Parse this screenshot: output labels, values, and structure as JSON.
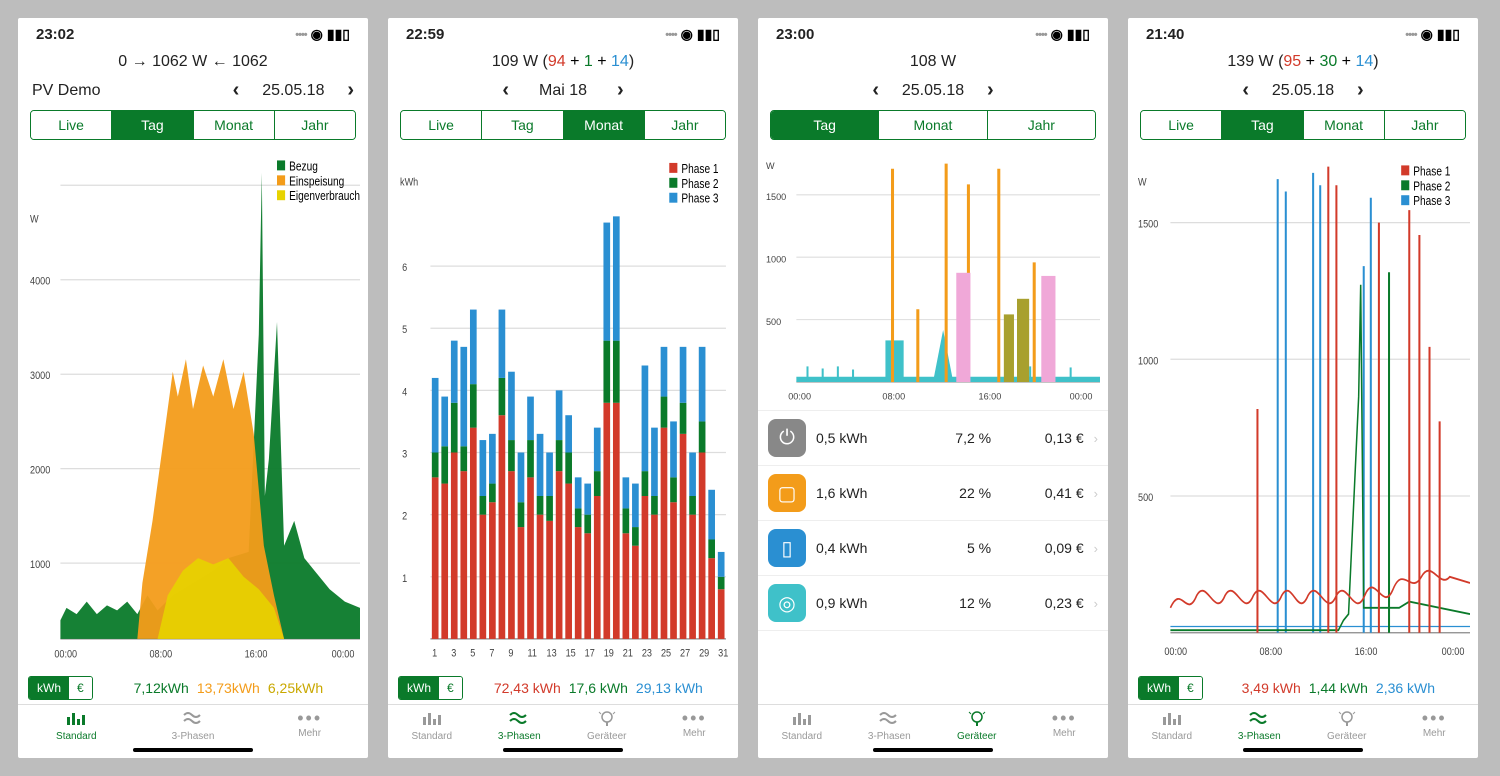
{
  "colors": {
    "green": "#0a7a2a",
    "orange": "#f39c1a",
    "yellow": "#e7d300",
    "red": "#d23a2a",
    "blue": "#2a8fd2",
    "teal": "#3fc1c9",
    "pink": "#f0a8d8",
    "olive": "#a8a02e",
    "gray": "#888"
  },
  "screens": [
    {
      "statusbar_time": "23:02",
      "summary_html": "0 → 1062 W ← 1062",
      "nav_left_label": "PV Demo",
      "nav_date": "25.05.18",
      "segments": [
        "Live",
        "Tag",
        "Monat",
        "Jahr"
      ],
      "segment_active": 1,
      "legend": [
        {
          "label": "Bezug",
          "color": "#0a7a2a"
        },
        {
          "label": "Einspeisung",
          "color": "#f39c1a"
        },
        {
          "label": "Eigenverbrauch",
          "color": "#e7d300"
        }
      ],
      "unit_options": [
        "kWh",
        "€"
      ],
      "unit_active": 0,
      "footer_values": [
        {
          "text": "7,12kWh",
          "color": "#0a7a2a"
        },
        {
          "text": "13,73kWh",
          "color": "#f39c1a"
        },
        {
          "text": "6,25kWh",
          "color": "#c9a800"
        }
      ],
      "tabs": [
        {
          "label": "Standard",
          "icon": "bars"
        },
        {
          "label": "3-Phasen",
          "icon": "waves"
        },
        {
          "label": "Mehr",
          "icon": "dots"
        }
      ],
      "tab_active": 0
    },
    {
      "statusbar_time": "22:59",
      "summary_prefix": "109 W (",
      "summary_parts": [
        {
          "text": "94",
          "color": "#d23a2a"
        },
        {
          "text": " + ",
          "color": "#000"
        },
        {
          "text": "1",
          "color": "#0a7a2a"
        },
        {
          "text": " + ",
          "color": "#000"
        },
        {
          "text": "14",
          "color": "#2a8fd2"
        }
      ],
      "summary_suffix": ")",
      "nav_date": "Mai 18",
      "segments": [
        "Live",
        "Tag",
        "Monat",
        "Jahr"
      ],
      "segment_active": 2,
      "legend": [
        {
          "label": "Phase 1",
          "color": "#d23a2a"
        },
        {
          "label": "Phase 2",
          "color": "#0a7a2a"
        },
        {
          "label": "Phase 3",
          "color": "#2a8fd2"
        }
      ],
      "unit_options": [
        "kWh",
        "€"
      ],
      "unit_active": 0,
      "footer_values": [
        {
          "text": "72,43 kWh",
          "color": "#d23a2a"
        },
        {
          "text": "17,6 kWh",
          "color": "#0a7a2a"
        },
        {
          "text": "29,13 kWh",
          "color": "#2a8fd2"
        }
      ],
      "tabs": [
        {
          "label": "Standard",
          "icon": "bars"
        },
        {
          "label": "3-Phasen",
          "icon": "waves"
        },
        {
          "label": "Geräteer",
          "icon": "bulb"
        },
        {
          "label": "Mehr",
          "icon": "dots"
        }
      ],
      "tab_active": 1
    },
    {
      "statusbar_time": "23:00",
      "summary_html": "108 W",
      "nav_date": "25.05.18",
      "segments": [
        "Tag",
        "Monat",
        "Jahr"
      ],
      "segment_active": 0,
      "unit_options": [
        "kWh",
        "€"
      ],
      "unit_active": 0,
      "devices": [
        {
          "icon_bg": "#888",
          "glyph": "⏻",
          "kwh": "0,5 kWh",
          "pct": "7,2 %",
          "eur": "0,13 €"
        },
        {
          "icon_bg": "#f39c1a",
          "glyph": "▢",
          "kwh": "1,6 kWh",
          "pct": "22 %",
          "eur": "0,41 €"
        },
        {
          "icon_bg": "#2a8fd2",
          "glyph": "▯",
          "kwh": "0,4 kWh",
          "pct": "5 %",
          "eur": "0,09 €"
        },
        {
          "icon_bg": "#3fc1c9",
          "glyph": "◎",
          "kwh": "0,9 kWh",
          "pct": "12 %",
          "eur": "0,23 €"
        }
      ],
      "tabs": [
        {
          "label": "Standard",
          "icon": "bars"
        },
        {
          "label": "3-Phasen",
          "icon": "waves"
        },
        {
          "label": "Geräteer",
          "icon": "bulb"
        },
        {
          "label": "Mehr",
          "icon": "dots"
        }
      ],
      "tab_active": 2
    },
    {
      "statusbar_time": "21:40",
      "summary_prefix": "139 W (",
      "summary_parts": [
        {
          "text": "95",
          "color": "#d23a2a"
        },
        {
          "text": " + ",
          "color": "#000"
        },
        {
          "text": "30",
          "color": "#0a7a2a"
        },
        {
          "text": " + ",
          "color": "#000"
        },
        {
          "text": "14",
          "color": "#2a8fd2"
        }
      ],
      "summary_suffix": ")",
      "nav_date": "25.05.18",
      "segments": [
        "Live",
        "Tag",
        "Monat",
        "Jahr"
      ],
      "segment_active": 1,
      "legend": [
        {
          "label": "Phase 1",
          "color": "#d23a2a"
        },
        {
          "label": "Phase 2",
          "color": "#0a7a2a"
        },
        {
          "label": "Phase 3",
          "color": "#2a8fd2"
        }
      ],
      "unit_options": [
        "kWh",
        "€"
      ],
      "unit_active": 0,
      "footer_values": [
        {
          "text": "3,49 kWh",
          "color": "#d23a2a"
        },
        {
          "text": "1,44 kWh",
          "color": "#0a7a2a"
        },
        {
          "text": "2,36 kWh",
          "color": "#2a8fd2"
        }
      ],
      "tabs": [
        {
          "label": "Standard",
          "icon": "bars"
        },
        {
          "label": "3-Phasen",
          "icon": "waves"
        },
        {
          "label": "Geräteer",
          "icon": "bulb"
        },
        {
          "label": "Mehr",
          "icon": "dots"
        }
      ],
      "tab_active": 1
    }
  ],
  "chart_data": [
    {
      "screen": 0,
      "type": "area",
      "xlabel": "",
      "ylabel": "W",
      "x_ticks": [
        "00:00",
        "08:00",
        "16:00",
        "00:00"
      ],
      "y_ticks": [
        1000,
        2000,
        3000,
        4000
      ],
      "ylim": [
        0,
        5200
      ],
      "note": "Daily power profile. Bezug = grid draw (green), Einspeisung = feed-in (orange), Eigenverbrauch = self-consumption (yellow). Large green spike ~16:00 to ~5000W."
    },
    {
      "screen": 1,
      "type": "bar",
      "ylabel": "kWh",
      "x_ticks": [
        1,
        3,
        5,
        7,
        9,
        11,
        13,
        15,
        17,
        19,
        21,
        23,
        25,
        27,
        29,
        31
      ],
      "y_ticks": [
        1,
        2,
        3,
        4,
        5,
        6
      ],
      "ylim": [
        0,
        7
      ],
      "categories": [
        1,
        2,
        3,
        4,
        5,
        6,
        7,
        8,
        9,
        10,
        11,
        12,
        13,
        14,
        15,
        16,
        17,
        18,
        19,
        20,
        21,
        22,
        23,
        24,
        25,
        26,
        27,
        28,
        29,
        30,
        31
      ],
      "series": [
        {
          "name": "Phase 1",
          "color": "#d23a2a",
          "values": [
            2.6,
            2.5,
            3.0,
            2.7,
            3.4,
            2.0,
            2.2,
            3.6,
            2.7,
            1.8,
            2.6,
            2.0,
            1.9,
            2.7,
            2.5,
            1.8,
            1.7,
            2.3,
            3.8,
            3.8,
            1.7,
            1.5,
            2.3,
            2.0,
            3.4,
            2.2,
            3.3,
            2.0,
            3.0,
            1.3,
            0.8
          ]
        },
        {
          "name": "Phase 2",
          "color": "#0a7a2a",
          "values": [
            0.4,
            0.6,
            0.8,
            0.4,
            0.7,
            0.3,
            0.3,
            0.6,
            0.5,
            0.4,
            0.6,
            0.3,
            0.4,
            0.5,
            0.5,
            0.3,
            0.3,
            0.4,
            1.0,
            1.0,
            0.4,
            0.3,
            0.4,
            0.3,
            0.5,
            0.4,
            0.5,
            0.3,
            0.5,
            0.3,
            0.2
          ]
        },
        {
          "name": "Phase 3",
          "color": "#2a8fd2",
          "values": [
            1.2,
            0.8,
            1.0,
            1.6,
            1.2,
            0.9,
            0.8,
            1.1,
            1.1,
            0.8,
            0.7,
            1.0,
            0.7,
            0.8,
            0.6,
            0.5,
            0.5,
            0.7,
            1.9,
            2.0,
            0.5,
            0.7,
            1.7,
            1.1,
            0.8,
            0.9,
            0.9,
            0.7,
            1.2,
            0.8,
            0.4
          ]
        }
      ]
    },
    {
      "screen": 2,
      "type": "line",
      "ylabel": "W",
      "x_ticks": [
        "00:00",
        "08:00",
        "16:00",
        "00:00"
      ],
      "y_ticks": [
        500,
        1000,
        1500
      ],
      "ylim": [
        0,
        2000
      ],
      "note": "Device disaggregation day profile. Teal base ~50W, orange spikes ~1800W around 08:00/12:00/14:00/16:00, pink blocks ~850W, olive ~600W after 16:00."
    },
    {
      "screen": 3,
      "type": "line",
      "ylabel": "W",
      "x_ticks": [
        "00:00",
        "08:00",
        "16:00",
        "00:00"
      ],
      "y_ticks": [
        500,
        1000,
        1500
      ],
      "ylim": [
        0,
        2000
      ],
      "note": "3-phase daily power. Phase1 red periodic ~120-200W baseline with spikes to ~1600-1800W, Phase2 green mostly flat low with spikes to ~1300W afternoon, Phase3 blue flat low with tall thin spikes to ~1800W morning/afternoon."
    }
  ]
}
